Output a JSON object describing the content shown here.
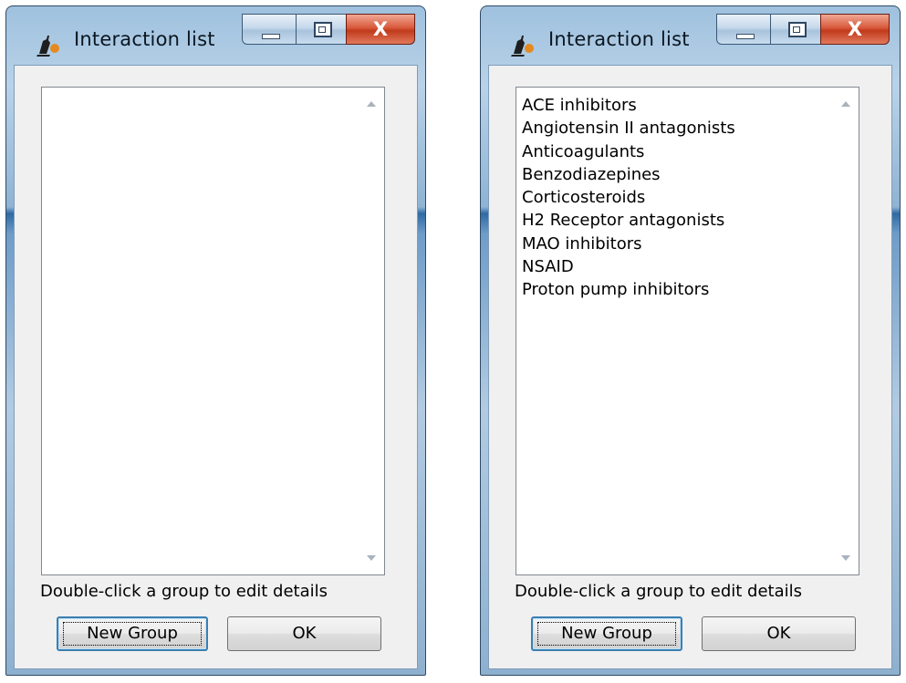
{
  "windows": [
    {
      "title": "Interaction list",
      "items": [],
      "hint": "Double-click a group to edit details",
      "new_group_label": "New Group",
      "ok_label": "OK",
      "close_glyph": "X"
    },
    {
      "title": "Interaction list",
      "items": [
        "ACE inhibitors",
        "Angiotensin II antagonists",
        "Anticoagulants",
        "Benzodiazepines",
        "Corticosteroids",
        "H2 Receptor antagonists",
        "MAO inhibitors",
        "NSAID",
        "Proton pump inhibitors"
      ],
      "hint": "Double-click a group to edit details",
      "new_group_label": "New Group",
      "ok_label": "OK",
      "close_glyph": "X"
    }
  ],
  "colors": {
    "title_text": "#0b1620",
    "close_button": "#c13a1c",
    "focus_border": "#3c7fb1",
    "dialog_background": "#f0f0f0"
  },
  "icons": {
    "app": "pill-bottle-icon",
    "minimize": "minimize-icon",
    "maximize": "maximize-icon",
    "close": "close-icon"
  }
}
